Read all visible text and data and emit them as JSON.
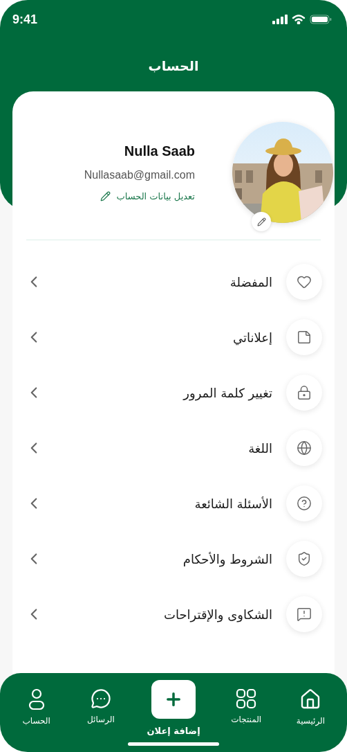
{
  "status_bar": {
    "time": "9:41"
  },
  "header": {
    "title": "الحساب"
  },
  "profile": {
    "name": "Nulla Saab",
    "email": "Nullasaab@gmail.com",
    "edit_link": "تعديل بيانات الحساب"
  },
  "menu": [
    {
      "label": "المفضلة"
    },
    {
      "label": "إعلاناتي"
    },
    {
      "label": "تغيير كلمة المرور"
    },
    {
      "label": "اللغة"
    },
    {
      "label": "الأسئلة الشائعة"
    },
    {
      "label": "الشروط والأحكام"
    },
    {
      "label": "الشكاوى والإقتراحات"
    }
  ],
  "bottom_nav": [
    {
      "label": "الرئيسية",
      "kind": "tab"
    },
    {
      "label": "المنتجات",
      "kind": "tab"
    },
    {
      "label": "إضافة إعلان",
      "kind": "action"
    },
    {
      "label": "الرسائل",
      "kind": "tab"
    },
    {
      "label": "الحساب",
      "kind": "tab"
    }
  ]
}
